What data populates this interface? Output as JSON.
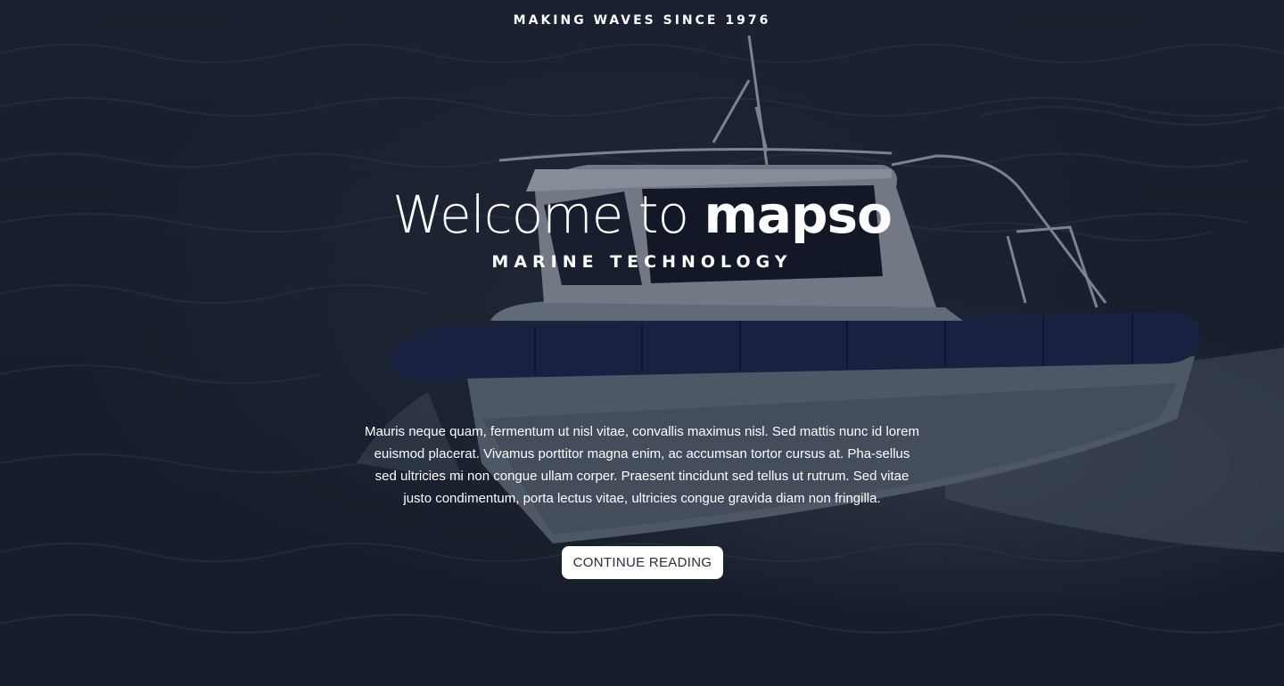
{
  "header": {
    "tagline": "MAKING WAVES SINCE 1976"
  },
  "hero": {
    "headline_prefix": "Welcome to ",
    "headline_brand": "mapso",
    "subheadline": "MARINE TECHNOLOGY",
    "body": "Mauris neque quam, fermentum ut nisl vitae, convallis maximus nisl. Sed mattis nunc id lorem euismod placerat. Vivamus porttitor magna enim, ac accumsan tortor cursus at. Pha-sellus sed ultricies mi non congue ullam corper. Praesent tincidunt sed tellus ut rutrum. Sed vitae justo condimentum, porta lectus vitae, ultricies congue gravida diam non fringilla.",
    "cta_label": "CONTINUE READING"
  },
  "colors": {
    "overlay": "#1a2230",
    "text": "#ffffff",
    "button_bg": "#ffffff",
    "button_text": "#2a2f3a"
  }
}
